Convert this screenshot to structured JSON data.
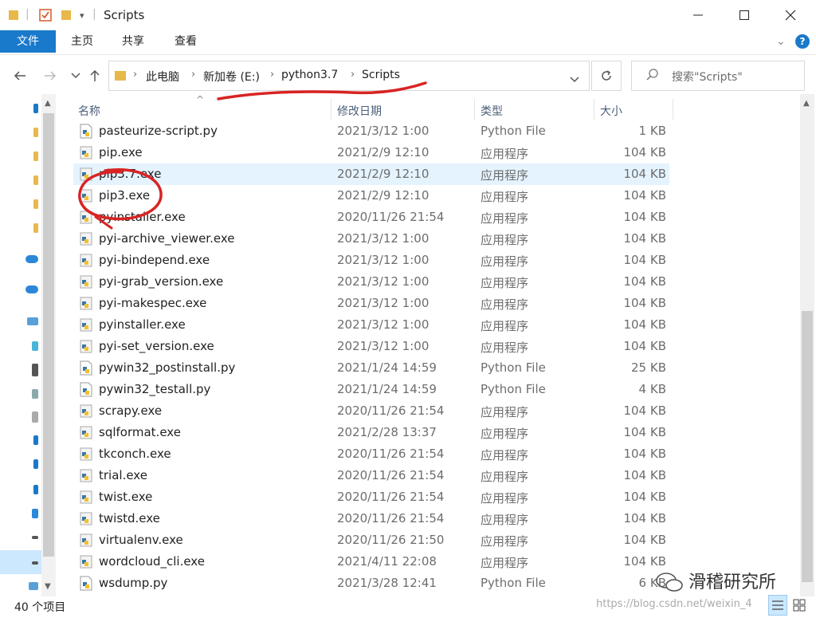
{
  "window": {
    "title": "Scripts",
    "minimize_icon": "minimize-icon",
    "maximize_icon": "maximize-icon",
    "close_icon": "close-icon"
  },
  "ribbon": {
    "tabs": [
      "文件",
      "主页",
      "共享",
      "查看"
    ],
    "accent": "#1979ca"
  },
  "address": {
    "breadcrumbs": [
      "此电脑",
      "新加卷 (E:)",
      "python3.7",
      "Scripts"
    ],
    "search_placeholder": "搜索\"Scripts\""
  },
  "list": {
    "columns": [
      "名称",
      "修改日期",
      "类型",
      "大小"
    ],
    "rows": [
      {
        "name": "pasteurize-script.py",
        "date": "2021/3/12 1:00",
        "type": "Python File",
        "size": "1 KB",
        "icon": "py"
      },
      {
        "name": "pip.exe",
        "date": "2021/2/9 12:10",
        "type": "应用程序",
        "size": "104 KB",
        "icon": "exe"
      },
      {
        "name": "pip3.7.exe",
        "date": "2021/2/9 12:10",
        "type": "应用程序",
        "size": "104 KB",
        "icon": "exe",
        "selected": true
      },
      {
        "name": "pip3.exe",
        "date": "2021/2/9 12:10",
        "type": "应用程序",
        "size": "104 KB",
        "icon": "exe"
      },
      {
        "name": "pyinstaller.exe",
        "date": "2020/11/26 21:54",
        "type": "应用程序",
        "size": "104 KB",
        "icon": "exe"
      },
      {
        "name": "pyi-archive_viewer.exe",
        "date": "2021/3/12 1:00",
        "type": "应用程序",
        "size": "104 KB",
        "icon": "exe"
      },
      {
        "name": "pyi-bindepend.exe",
        "date": "2021/3/12 1:00",
        "type": "应用程序",
        "size": "104 KB",
        "icon": "exe"
      },
      {
        "name": "pyi-grab_version.exe",
        "date": "2021/3/12 1:00",
        "type": "应用程序",
        "size": "104 KB",
        "icon": "exe"
      },
      {
        "name": "pyi-makespec.exe",
        "date": "2021/3/12 1:00",
        "type": "应用程序",
        "size": "104 KB",
        "icon": "exe"
      },
      {
        "name": "pyinstaller.exe",
        "date": "2021/3/12 1:00",
        "type": "应用程序",
        "size": "104 KB",
        "icon": "exe"
      },
      {
        "name": "pyi-set_version.exe",
        "date": "2021/3/12 1:00",
        "type": "应用程序",
        "size": "104 KB",
        "icon": "exe"
      },
      {
        "name": "pywin32_postinstall.py",
        "date": "2021/1/24 14:59",
        "type": "Python File",
        "size": "25 KB",
        "icon": "py"
      },
      {
        "name": "pywin32_testall.py",
        "date": "2021/1/24 14:59",
        "type": "Python File",
        "size": "4 KB",
        "icon": "py"
      },
      {
        "name": "scrapy.exe",
        "date": "2020/11/26 21:54",
        "type": "应用程序",
        "size": "104 KB",
        "icon": "exe"
      },
      {
        "name": "sqlformat.exe",
        "date": "2021/2/28 13:37",
        "type": "应用程序",
        "size": "104 KB",
        "icon": "exe"
      },
      {
        "name": "tkconch.exe",
        "date": "2020/11/26 21:54",
        "type": "应用程序",
        "size": "104 KB",
        "icon": "exe"
      },
      {
        "name": "trial.exe",
        "date": "2020/11/26 21:54",
        "type": "应用程序",
        "size": "104 KB",
        "icon": "exe"
      },
      {
        "name": "twist.exe",
        "date": "2020/11/26 21:54",
        "type": "应用程序",
        "size": "104 KB",
        "icon": "exe"
      },
      {
        "name": "twistd.exe",
        "date": "2020/11/26 21:54",
        "type": "应用程序",
        "size": "104 KB",
        "icon": "exe"
      },
      {
        "name": "virtualenv.exe",
        "date": "2020/11/26 21:50",
        "type": "应用程序",
        "size": "104 KB",
        "icon": "exe"
      },
      {
        "name": "wordcloud_cli.exe",
        "date": "2021/4/11 22:08",
        "type": "应用程序",
        "size": "104 KB",
        "icon": "exe"
      },
      {
        "name": "wsdump.py",
        "date": "2021/3/28 12:41",
        "type": "Python File",
        "size": "6 KB",
        "icon": "py"
      }
    ]
  },
  "status": {
    "item_count": "40 个项目"
  },
  "watermark": {
    "brand": "滑稽研究所",
    "url": "https://blog.csdn.net/weixin_4"
  }
}
